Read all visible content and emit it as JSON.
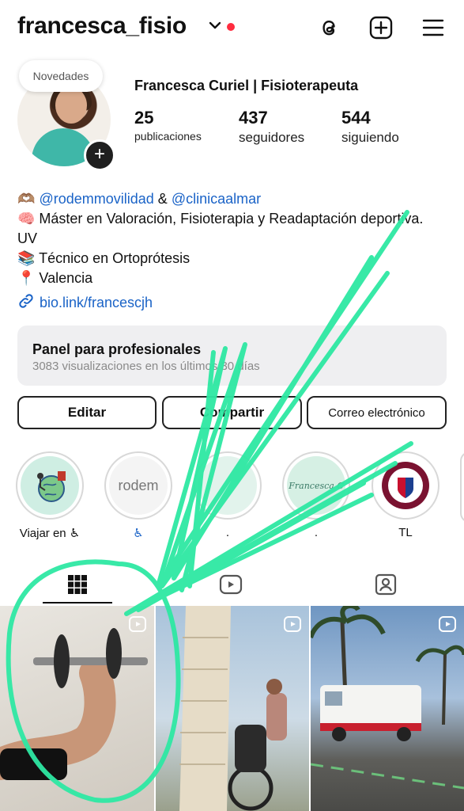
{
  "header": {
    "username": "francesca_fisio",
    "icons": [
      "threads-icon",
      "create-post-icon",
      "menu-icon"
    ]
  },
  "profile": {
    "notes_bubble": "Novedades",
    "display_name": "Francesca Curiel | Fisioterapeuta",
    "stats": [
      {
        "value": "25",
        "label": "publicaciones"
      },
      {
        "value": "437",
        "label": "seguidores"
      },
      {
        "value": "544",
        "label": "siguiendo"
      }
    ]
  },
  "bio": {
    "line1_emoji": "🫶🏽",
    "mention1": "@rodemmovilidad",
    "amp": "&",
    "mention2": "@clinicaalmar",
    "line2": "🧠 Máster en Valoración, Fisioterapia y Readaptación deportiva. UV",
    "line3": "📚 Técnico en Ortoprótesis",
    "line4": "📍 Valencia",
    "link": "bio.link/francescjh"
  },
  "panel": {
    "title": "Panel para profesionales",
    "subtitle": "3083 visualizaciones en los últimos 30 días"
  },
  "buttons": {
    "edit": "Editar",
    "share": "Compartir",
    "email": "Correo electrónico"
  },
  "highlights": [
    {
      "label": "Viajar en ♿"
    },
    {
      "label": "♿",
      "logo_text": "rodem"
    },
    {
      "label": "."
    },
    {
      "label": "."
    },
    {
      "label": "TL"
    }
  ],
  "tabs": [
    "grid-icon",
    "reels-icon",
    "tagged-icon"
  ],
  "colors": {
    "link": "#1a63c7",
    "notification_dot": "#ff2c3f",
    "scribble": "#2ee8a3",
    "panel_bg": "#efeff1"
  }
}
